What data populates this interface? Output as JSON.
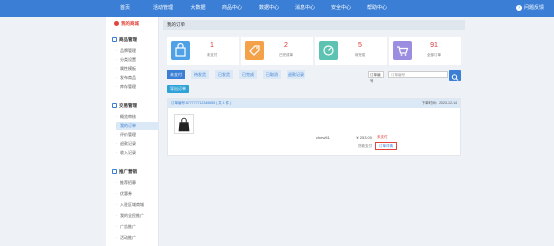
{
  "topnav": {
    "items": [
      "首页",
      "活动管理",
      "大数据",
      "商品中心",
      "数据中心",
      "消息中心",
      "安全中心",
      "帮助中心"
    ],
    "help": "问题反馈"
  },
  "sidebar": {
    "brand": "我的商城",
    "sections": [
      {
        "title": "商品管理",
        "items": [
          "品牌管理",
          "分类设置",
          "属性模板",
          "发布商品",
          "库存管理"
        ]
      },
      {
        "title": "交易管理",
        "items": [
          "概览审核",
          "我的订单",
          "评价管理",
          "退款记录",
          "收入记录"
        ]
      },
      {
        "title": "推广营销",
        "items": [
          "推荐招募",
          "优惠券",
          "入驻区域商城",
          "我的全民推广",
          "广告推广",
          "活动推广"
        ]
      }
    ]
  },
  "page_title": "我的订单",
  "stats": [
    {
      "value": "1",
      "label": "未支付",
      "color": "#4ea1e6"
    },
    {
      "value": "2",
      "label": "已完成单",
      "color": "#f3a24a"
    },
    {
      "value": "5",
      "label": "待完成",
      "color": "#5cc3b2"
    },
    {
      "value": "91",
      "label": "全部订单",
      "color": "#9b8ee0"
    }
  ],
  "tabs": [
    "未支付",
    "待发货",
    "已发货",
    "已完成",
    "已取消",
    "退款记录"
  ],
  "filter": "订单编号",
  "search_placeholder": "订单编号",
  "export_label": "导出订单",
  "order": {
    "number": "订单编号:877777712345655 ( 共 1 件 )",
    "date": "下单时间：2023-12-14",
    "buyer": "chew51",
    "price": "¥ 253.00",
    "paid": "货款支付",
    "status": "未支付",
    "detail": "订单详情"
  }
}
